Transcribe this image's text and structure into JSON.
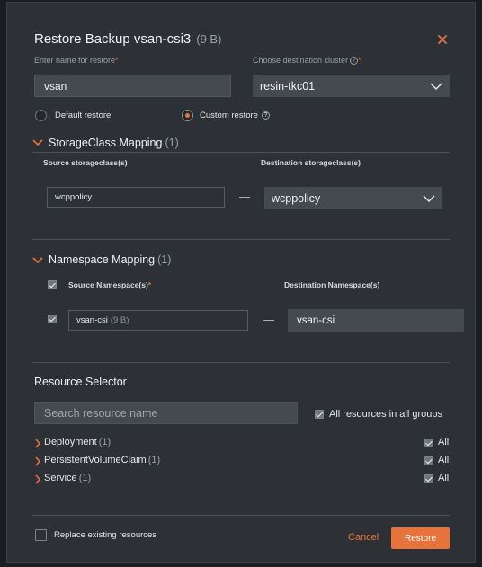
{
  "dialog": {
    "title": "Restore Backup vsan-csi3",
    "title_size": "(9 B)"
  },
  "restore_name": {
    "label": "Enter name for restore",
    "required_mark": "*",
    "value": "vsan"
  },
  "destination_cluster": {
    "label": "Choose destination cluster",
    "help_mark": "?",
    "required_mark": "*",
    "value": "resin-tkc01"
  },
  "restore_type": {
    "default_label": "Default restore",
    "custom_label": "Custom restore",
    "selected": "custom",
    "custom_help_mark": "?"
  },
  "storageclass_mapping": {
    "title": "StorageClass Mapping",
    "count": "(1)",
    "source_header": "Source storageclass(s)",
    "destination_header": "Destination storageclass(s)",
    "rows": [
      {
        "source": "wcppolicy",
        "destination": "wcppolicy"
      }
    ]
  },
  "namespace_mapping": {
    "title": "Namespace Mapping",
    "count": "(1)",
    "source_header": "Source Namespace(s)",
    "required_mark": "*",
    "destination_header": "Destination Namespace(s)",
    "rows": [
      {
        "source": "vsan-csi",
        "source_size": "(9 B)",
        "destination": "vsan-csi",
        "checked": true
      }
    ]
  },
  "resource_selector": {
    "title": "Resource Selector",
    "search_placeholder": "Search resource name",
    "all_groups_label": "All resources in all groups",
    "items": [
      {
        "name": "Deployment",
        "count": "(1)",
        "all_label": "All"
      },
      {
        "name": "PersistentVolumeClaim",
        "count": "(1)",
        "all_label": "All"
      },
      {
        "name": "Service",
        "count": "(1)",
        "all_label": "All"
      }
    ]
  },
  "footer": {
    "replace_label": "Replace existing resources",
    "cancel_label": "Cancel",
    "restore_label": "Restore"
  },
  "colors": {
    "accent": "#e8733a",
    "panel": "#2d3136",
    "input": "#454a50"
  }
}
